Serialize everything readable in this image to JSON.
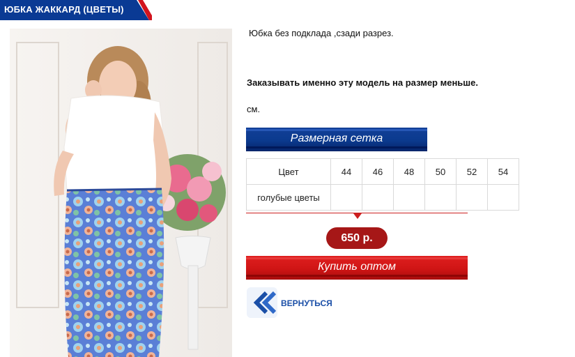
{
  "product": {
    "title": "ЮБКА ЖАККАРД (ЦВЕТЫ)",
    "description": "Юбка без подклада ,сзади разрез.",
    "size_note": "Заказывать именно эту модель на размер меньше.",
    "unit": "см.",
    "photo_icon": "product-photo"
  },
  "size_grid": {
    "header_label": "Размерная сетка",
    "header_row": [
      "Цвет",
      "44",
      "46",
      "48",
      "50",
      "52",
      "54"
    ],
    "rows": [
      [
        "голубые цветы",
        "",
        "",
        "",
        "",
        "",
        ""
      ]
    ]
  },
  "price": {
    "label": "650 р."
  },
  "actions": {
    "buy_label": "Купить оптом",
    "back_label": "ВЕРНУТЬСЯ",
    "back_icon": "double-chevron-left-icon"
  },
  "colors": {
    "title_blue": "#0a3a94",
    "title_red": "#d2141e",
    "grid_blue": "#0b3a8e",
    "buy_red": "#d11717",
    "price_red": "#a61717",
    "link_blue": "#1b4fa7"
  }
}
